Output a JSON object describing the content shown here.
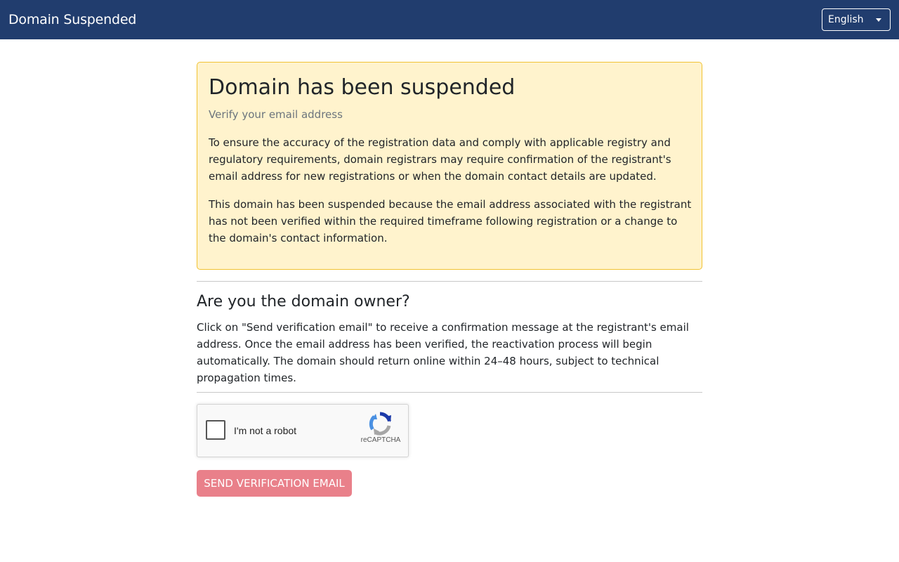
{
  "navbar": {
    "title": "Domain Suspended",
    "language_label": "English"
  },
  "alert": {
    "heading": "Domain has been suspended",
    "subheading": "Verify your email address",
    "paragraph1": "To ensure the accuracy of the registration data and comply with applicable registry and regulatory requirements, domain registrars may require confirmation of the registrant's email address for new registrations or when the domain contact details are updated.",
    "paragraph2": "This domain has been suspended because the email address associated with the registrant has not been verified within the required timeframe following registration or a change to the domain's contact information."
  },
  "owner": {
    "heading": "Are you the domain owner?",
    "text": "Click on \"Send verification email\" to receive a confirmation message at the registrant's email address. Once the email address has been verified, the reactivation process will begin automatically. The domain should return online within 24–48 hours, subject to technical propagation times."
  },
  "captcha": {
    "label": "I'm not a robot",
    "brand": "reCAPTCHA",
    "checked": false
  },
  "actions": {
    "send_label": "SEND VERIFICATION EMAIL",
    "send_enabled": false
  },
  "colors": {
    "navbar_bg": "#213d6e",
    "alert_bg": "#fff3cd",
    "alert_border": "#f1c232",
    "button_disabled_bg": "#e9808a"
  },
  "icons": {
    "captcha_logo": "recaptcha-logo-icon",
    "language_dropdown": "caret-down-icon"
  }
}
